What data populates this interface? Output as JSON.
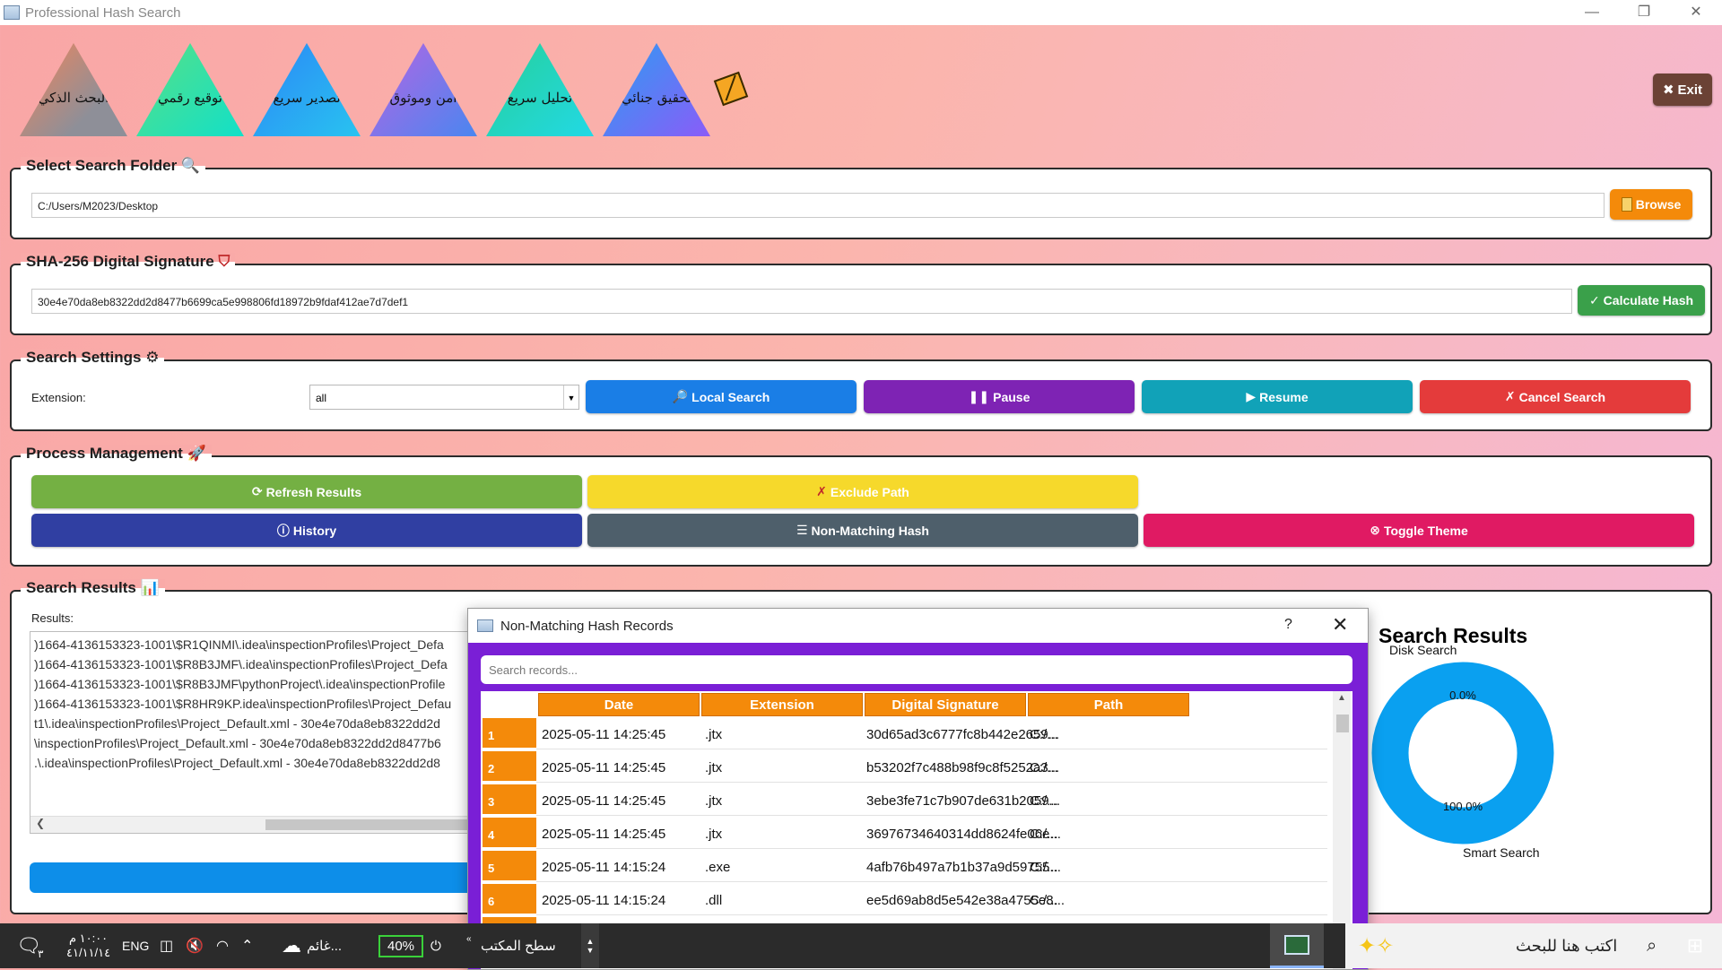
{
  "window": {
    "title": "Professional Hash Search",
    "controls": [
      "—",
      "❐",
      "✕"
    ]
  },
  "banner": {
    "triangles": [
      {
        "label": "البحث الذكي",
        "colors": [
          "#f0855b",
          "#8e8f98"
        ]
      },
      {
        "label": "توقيع رقمي",
        "colors": [
          "#58e085",
          "#12e0c8"
        ]
      },
      {
        "label": "تصدير سريع",
        "colors": [
          "#2a87f6",
          "#29c3f0"
        ]
      },
      {
        "label": "امن وموثوق",
        "colors": [
          "#b565e3",
          "#4a86f0"
        ]
      },
      {
        "label": "تحليل سريع",
        "colors": [
          "#26d09a",
          "#22d9e5"
        ]
      },
      {
        "label": "تحقيق جنائي",
        "colors": [
          "#2d9df2",
          "#8a5cf8"
        ]
      }
    ],
    "exit_label": "Exit"
  },
  "folder": {
    "title": "Select Search Folder 🔍",
    "path": "C:/Users/M2023/Desktop",
    "browse_label": "Browse"
  },
  "signature": {
    "title": "SHA-256 Digital Signature",
    "hash": "30e4e70da8eb8322dd2d8477b6699ca5e998806fd18972b9fdaf412ae7d7def1",
    "calc_label": "Calculate Hash"
  },
  "settings": {
    "title": "Search Settings",
    "extension_label": "Extension:",
    "extension_value": "all",
    "local_label": "Local Search",
    "pause_label": "Pause",
    "resume_label": "Resume",
    "cancel_label": "Cancel Search"
  },
  "process": {
    "title": "Process Management",
    "refresh_label": "Refresh Results",
    "exclude_label": "Exclude Path",
    "history_label": "History",
    "nonmatch_label": "Non-Matching Hash",
    "theme_label": "Toggle Theme"
  },
  "results": {
    "title": "Search Results",
    "label": "Results:",
    "lines": [
      ")1664-4136153323-1001\\$R1QINMI\\.idea\\inspectionProfiles\\Project_Defa",
      ")1664-4136153323-1001\\$R8B3JMF\\.idea\\inspectionProfiles\\Project_Defa",
      ")1664-4136153323-1001\\$R8B3JMF\\pythonProject\\.idea\\inspectionProfile",
      ")1664-4136153323-1001\\$R8HR9KP.idea\\inspectionProfiles\\Project_Defau",
      "t1\\.idea\\inspectionProfiles\\Project_Default.xml - 30e4e70da8eb8322dd2d",
      "\\inspectionProfiles\\Project_Default.xml - 30e4e70da8eb8322dd2d8477b6",
      ".\\.idea\\inspectionProfiles\\Project_Default.xml - 30e4e70da8eb8322dd2d8"
    ]
  },
  "chart_data": {
    "type": "pie",
    "title": "Search Results",
    "categories": [
      "Disk Search",
      "Smart Search"
    ],
    "values": [
      0.0,
      100.0
    ],
    "value_labels": [
      "0.0%",
      "100.0%"
    ],
    "colors": [
      "#0aa0f0",
      "#0aa0f0"
    ]
  },
  "dialog": {
    "title": "Non-Matching Hash Records",
    "help": "?",
    "close": "✕",
    "search_placeholder": "Search records...",
    "columns": [
      "Date",
      "Extension",
      "Digital Signature",
      "Path"
    ],
    "rows": [
      {
        "n": "1",
        "date": "2025-05-11 14:25:45",
        "ext": ".jtx",
        "sig": "30d65ad3c6777fc8b442e2659...",
        "path": "C:/..."
      },
      {
        "n": "2",
        "date": "2025-05-11 14:25:45",
        "ext": ".jtx",
        "sig": "b53202f7c488b98f9c8f5252a3...",
        "path": "C:/..."
      },
      {
        "n": "3",
        "date": "2025-05-11 14:25:45",
        "ext": ".jtx",
        "sig": "3ebe3fe71c7b907de631b2059...",
        "path": "C:/..."
      },
      {
        "n": "4",
        "date": "2025-05-11 14:25:45",
        "ext": ".jtx",
        "sig": "36976734640314dd8624fe06e...",
        "path": "C:/..."
      },
      {
        "n": "5",
        "date": "2025-05-11 14:15:24",
        "ext": ".exe",
        "sig": "4afb76b497a7b1b37a9d59755...",
        "path": "C:/..."
      },
      {
        "n": "6",
        "date": "2025-05-11 14:15:24",
        "ext": ".dll",
        "sig": "ee5d69ab8d5e542e38a4755e8...",
        "path": "C:/..."
      }
    ]
  },
  "taskbar": {
    "search_text": "اكتب هنا للبحث",
    "desktop_label": "سطح المكتب",
    "battery": "40%",
    "weather": "غائم...",
    "lang": "ENG",
    "time": "١٠:٠٠ م",
    "date": "٤١/١١/١٤",
    "notif_count": "٣"
  }
}
